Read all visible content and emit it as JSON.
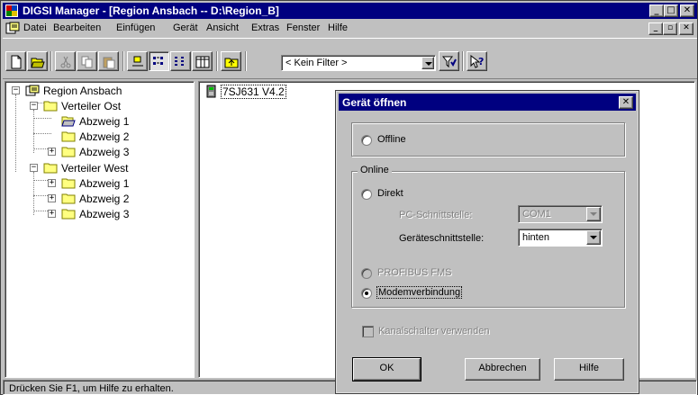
{
  "window": {
    "title": "DIGSI Manager - [Region Ansbach -- D:\\Region_B]",
    "controls": [
      "_",
      "□",
      "✕"
    ]
  },
  "menubar": {
    "items": [
      "Datei",
      "Bearbeiten",
      "Einfügen",
      "Gerät",
      "Ansicht",
      "Extras",
      "Fenster",
      "Hilfe"
    ],
    "mdi_controls": [
      "_",
      "▫",
      "✕"
    ]
  },
  "toolbar": {
    "filter_value": "< Kein Filter >"
  },
  "tree": {
    "root": "Region Ansbach",
    "groups": [
      {
        "label": "Verteiler Ost",
        "children": [
          "Abzweig 1",
          "Abzweig 2",
          "Abzweig 3"
        ]
      },
      {
        "label": "Verteiler West",
        "children": [
          "Abzweig 1",
          "Abzweig 2",
          "Abzweig 3"
        ]
      }
    ]
  },
  "list": {
    "device": "7SJ631 V4.2"
  },
  "statusbar": {
    "text": "Drücken Sie F1, um Hilfe zu erhalten."
  },
  "dialog": {
    "title": "Gerät öffnen",
    "close": "✕",
    "offline_label": "Offline",
    "online_group": "Online",
    "direkt_label": "Direkt",
    "pc_interface_label": "PC-Schnittstelle:",
    "pc_interface_value": "COM1",
    "device_interface_label": "Geräteschnittstelle:",
    "device_interface_value": "hinten",
    "profibus_label": "PROFIBUS FMS",
    "modem_label": "Modemverbindung",
    "selected_option": "Modemverbindung",
    "channel_switch_label": "Kanalschalter verwenden",
    "ok_label": "OK",
    "cancel_label": "Abbrechen",
    "help_label": "Hilfe"
  }
}
